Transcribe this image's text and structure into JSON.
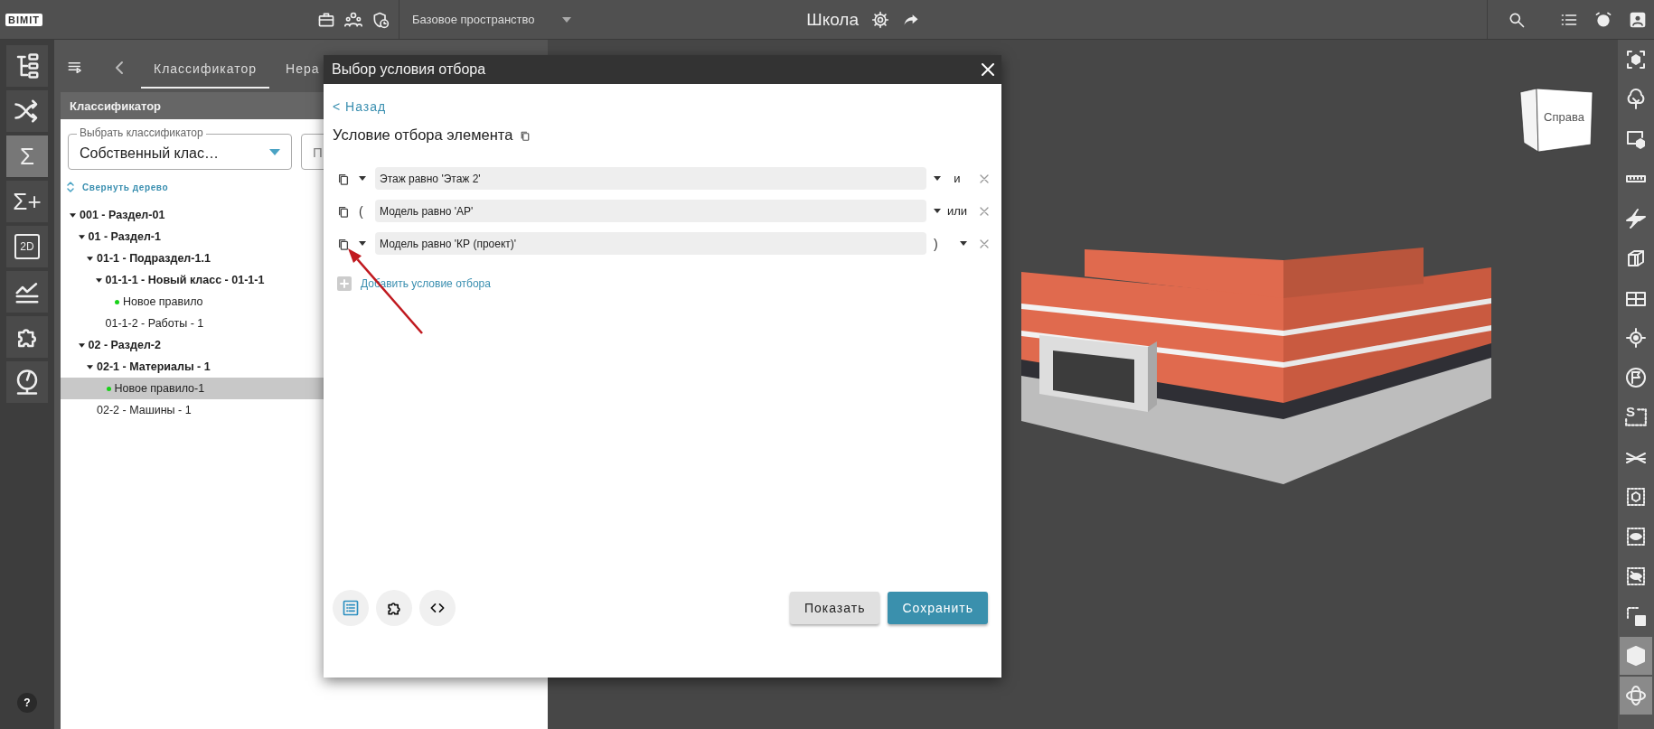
{
  "top_bar": {
    "logo": "BIMIT",
    "workspace": "Базовое пространство",
    "project_title": "Школа"
  },
  "left_toolbar": {
    "items": [
      {
        "kind": "tree",
        "selected": false
      },
      {
        "kind": "shuffle",
        "selected": false
      },
      {
        "kind": "glyph",
        "glyph": "Σ",
        "selected": true
      },
      {
        "kind": "glyph",
        "glyph": "Σ+",
        "selected": false
      },
      {
        "kind": "sheet",
        "glyph": "2D",
        "selected": false
      },
      {
        "kind": "chart",
        "selected": false
      },
      {
        "kind": "puzzle",
        "selected": false
      },
      {
        "kind": "gauge",
        "selected": false
      }
    ],
    "help": "?"
  },
  "panel": {
    "tabs": [
      {
        "label": "Классификатор",
        "selected": true
      },
      {
        "label": "Нера",
        "selected": false
      }
    ],
    "section_title": "Классификатор",
    "classifier_select": {
      "label": "Выбрать классификатор",
      "value": "Собственный клас…"
    },
    "second_field": {
      "value": "П"
    },
    "collapse_link": "Свернуть дерево",
    "tree": [
      {
        "label": "001 - Раздел-01",
        "kind": "group",
        "expanded": true,
        "selected": false,
        "children": [
          {
            "label": "01 - Раздел-1",
            "kind": "group",
            "expanded": true,
            "selected": false,
            "children": [
              {
                "label": "01-1 - Подраздел-1.1",
                "kind": "group",
                "expanded": true,
                "selected": false,
                "children": [
                  {
                    "label": "01-1-1 - Новый класс - 01-1-1",
                    "kind": "group",
                    "expanded": true,
                    "selected": false,
                    "children": [
                      {
                        "label": "Новое правило",
                        "kind": "rule",
                        "selected": false
                      }
                    ]
                  },
                  {
                    "label": "01-1-2 - Работы - 1",
                    "kind": "leaf",
                    "selected": false
                  }
                ]
              }
            ]
          },
          {
            "label": "02 - Раздел-2",
            "kind": "group",
            "expanded": true,
            "selected": false,
            "children": [
              {
                "label": "02-1 - Материалы - 1",
                "kind": "group",
                "expanded": true,
                "selected": false,
                "children": [
                  {
                    "label": "Новое правило-1",
                    "kind": "rule",
                    "selected": true
                  }
                ]
              },
              {
                "label": "02-2 - Машины - 1",
                "kind": "leaf",
                "selected": false
              }
            ]
          }
        ]
      }
    ]
  },
  "dialog": {
    "title": "Выбор условия отбора",
    "back_link": "< Назад",
    "heading": "Условие отбора элемента",
    "conditions": [
      {
        "text": "Этаж равно 'Этаж 2'",
        "operator": "и"
      },
      {
        "prefix": "(",
        "text": "Модель равно 'АР'",
        "operator": "или"
      },
      {
        "text": "Модель равно 'КР (проект)'",
        "suffix": ")"
      }
    ],
    "add_condition": "Добавить условие отбора",
    "tool_buttons": [
      {
        "kind": "list"
      },
      {
        "kind": "puzzle"
      },
      {
        "kind": "code"
      }
    ],
    "buttons": [
      {
        "label": "Показать",
        "kind": "secondary"
      },
      {
        "label": "Сохранить",
        "kind": "primary"
      }
    ]
  },
  "viewport": {
    "view_cube": "Справа"
  },
  "right_toolbar": {
    "items": [
      {
        "kind": "focus",
        "selected": false
      },
      {
        "kind": "tree",
        "selected": false
      },
      {
        "kind": "screen",
        "selected": false
      },
      {
        "kind": "ruler",
        "selected": false
      },
      {
        "kind": "section",
        "selected": false
      },
      {
        "kind": "box",
        "selected": false
      },
      {
        "kind": "plan",
        "selected": false
      },
      {
        "kind": "target",
        "selected": false
      },
      {
        "kind": "flag",
        "selected": false
      },
      {
        "kind": "select",
        "glyph": "S",
        "selected": false
      },
      {
        "kind": "grid",
        "selected": false
      },
      {
        "kind": "cube-sel",
        "selected": false
      },
      {
        "kind": "eye",
        "selected": false
      },
      {
        "kind": "eye-off",
        "selected": false
      },
      {
        "kind": "clear",
        "selected": false
      },
      {
        "kind": "solid",
        "selected": true
      },
      {
        "kind": "orbit",
        "selected": true
      }
    ]
  }
}
